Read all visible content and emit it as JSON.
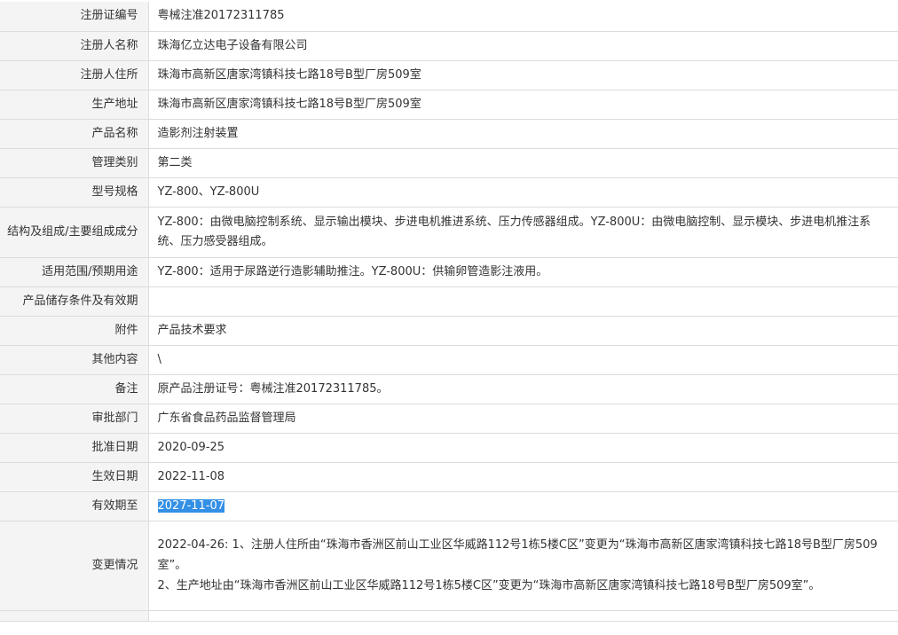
{
  "rows": [
    {
      "label": "注册证编号",
      "value": "粤械注准20172311785"
    },
    {
      "label": "注册人名称",
      "value": "珠海亿立达电子设备有限公司"
    },
    {
      "label": "注册人住所",
      "value": "珠海市高新区唐家湾镇科技七路18号B型厂房509室"
    },
    {
      "label": "生产地址",
      "value": "珠海市高新区唐家湾镇科技七路18号B型厂房509室"
    },
    {
      "label": "产品名称",
      "value": "造影剂注射装置"
    },
    {
      "label": "管理类别",
      "value": "第二类"
    },
    {
      "label": "型号规格",
      "value": "YZ-800、YZ-800U"
    },
    {
      "label": "结构及组成/主要组成成分",
      "value": "YZ-800：由微电脑控制系统、显示输出模块、步进电机推进系统、压力传感器组成。YZ-800U：由微电脑控制、显示模块、步进电机推注系统、压力感受器组成。"
    },
    {
      "label": "适用范围/预期用途",
      "value": "YZ-800：适用于尿路逆行造影辅助推注。YZ-800U：供输卵管造影注液用。"
    },
    {
      "label": "产品储存条件及有效期",
      "value": ""
    },
    {
      "label": "附件",
      "value": "产品技术要求"
    },
    {
      "label": "其他内容",
      "value": "\\"
    },
    {
      "label": "备注",
      "value": "原产品注册证号：粤械注准20172311785。"
    },
    {
      "label": "审批部门",
      "value": "广东省食品药品监督管理局"
    },
    {
      "label": "批准日期",
      "value": "2020-09-25"
    },
    {
      "label": "生效日期",
      "value": "2022-11-08"
    },
    {
      "label": "有效期至",
      "value": "2027-11-07"
    },
    {
      "label": "变更情况",
      "value_lines": [
        "2022-04-26: 1、注册人住所由“珠海市香洲区前山工业区华威路112号1栋5楼C区”变更为“珠海市高新区唐家湾镇科技七路18号B型厂房509室”。",
        "2、生产地址由“珠海市香洲区前山工业区华威路112号1栋5楼C区”变更为“珠海市高新区唐家湾镇科技七路18号B型厂房509室”。"
      ]
    }
  ]
}
